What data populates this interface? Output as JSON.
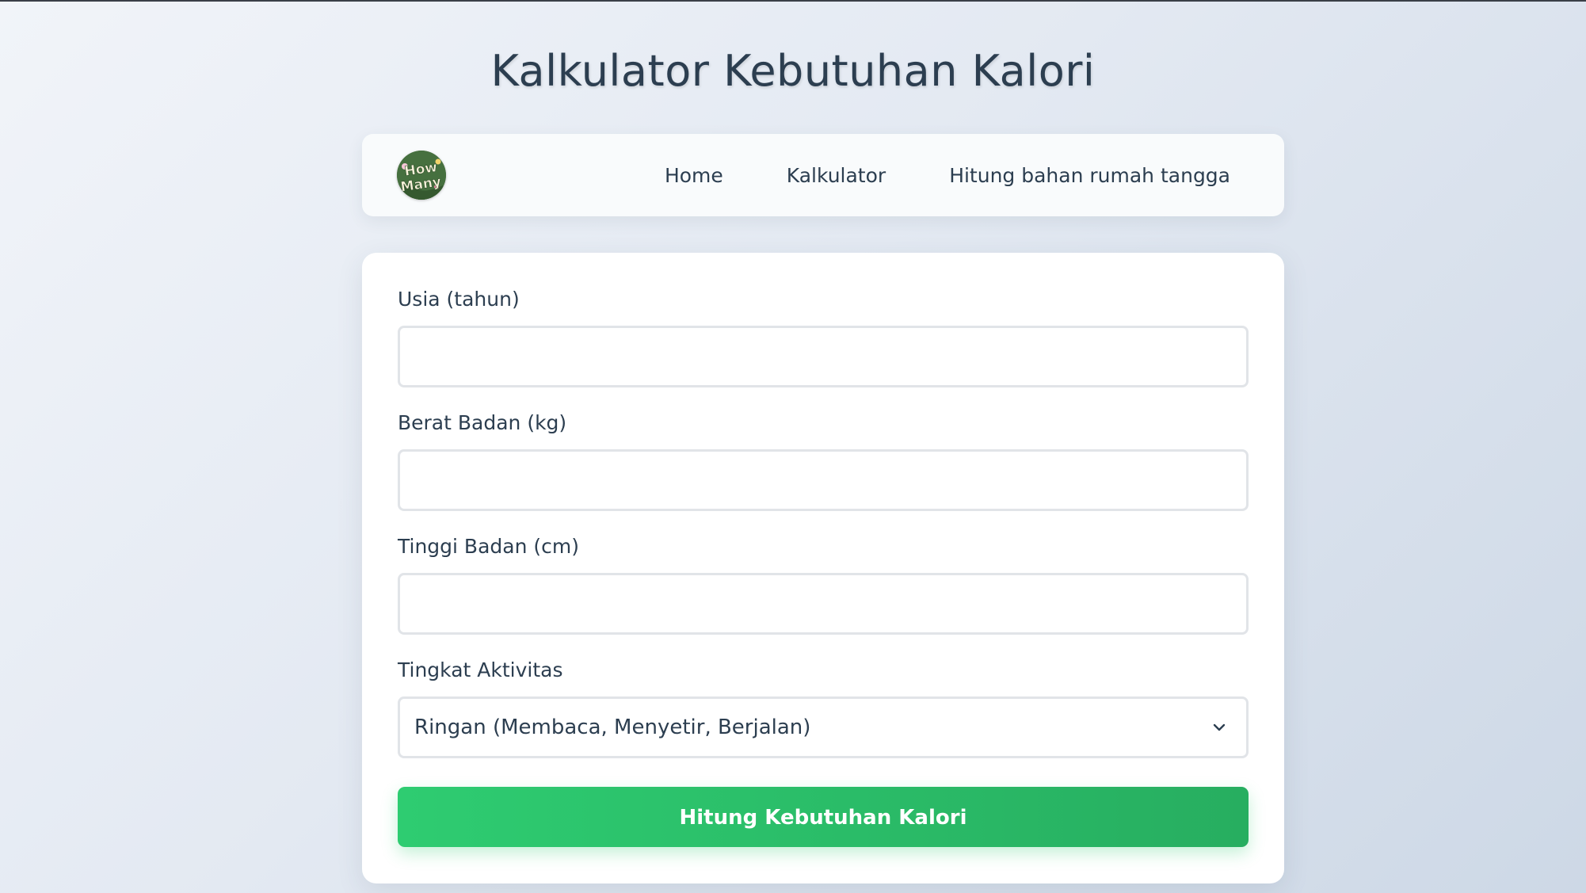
{
  "page": {
    "title": "Kalkulator Kebutuhan Kalori"
  },
  "navbar": {
    "logo_text": "How Many",
    "links": [
      {
        "label": "Home"
      },
      {
        "label": "Kalkulator"
      },
      {
        "label": "Hitung bahan rumah tangga"
      }
    ]
  },
  "form": {
    "age": {
      "label": "Usia (tahun)",
      "value": ""
    },
    "weight": {
      "label": "Berat Badan (kg)",
      "value": ""
    },
    "height": {
      "label": "Tinggi Badan (cm)",
      "value": ""
    },
    "activity": {
      "label": "Tingkat Aktivitas",
      "selected": "Ringan (Membaca, Menyetir, Berjalan)"
    },
    "submit_label": "Hitung Kebutuhan Kalori"
  },
  "colors": {
    "accent_start": "#2ecc71",
    "accent_end": "#27ae60",
    "text": "#2c3e50"
  },
  "icons": {
    "select_arrow": "chevron-down-icon",
    "logo": "how-many-logo"
  }
}
